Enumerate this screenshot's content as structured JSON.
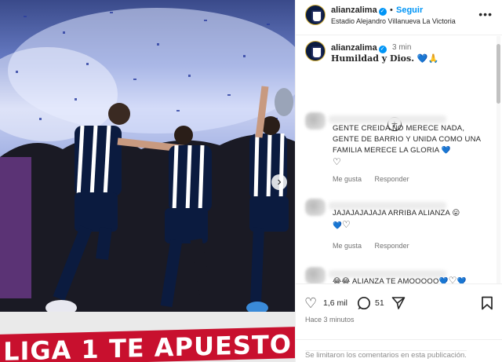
{
  "post": {
    "username": "alianzalima",
    "follow_label": "Seguir",
    "location": "Estadio Alejandro Villanueva La Victoria",
    "more_label": "•••",
    "banner_text": "LIGA 1 TE APUESTO",
    "next_label": "›"
  },
  "caption": {
    "username": "alianzalima",
    "time": "3 min",
    "text": "Humildad y Dios.",
    "emoji": "💙🙏"
  },
  "comments": [
    {
      "text": "GENTE CREIDA NO MERECE NADA, GENTE DE BARRIO Y UNIDA COMO UNA FAMILIA MERECE LA GLORIA",
      "emoji": "💙",
      "like_label": "Me gusta",
      "reply_label": "Responder"
    },
    {
      "text": "JAJAJAJAJAJA ARRIBA ALIANZA",
      "emoji": "😛",
      "line2": "💙",
      "like_label": "Me gusta",
      "reply_label": "Responder"
    },
    {
      "text": "ALIANZA TE AMOOOOO",
      "emoji_prefix": "😂😂",
      "emoji": "💙",
      "emoji_end": "💙"
    }
  ],
  "actions": {
    "likes": "1,6 mil",
    "comments": "51",
    "posted": "Hace 3 minutos",
    "limited": "Se limitaron los comentarios en esta publicación."
  },
  "colors": {
    "accent": "#0095f6",
    "banner_red": "#c8102e",
    "jersey_navy": "#0b1b3f"
  }
}
